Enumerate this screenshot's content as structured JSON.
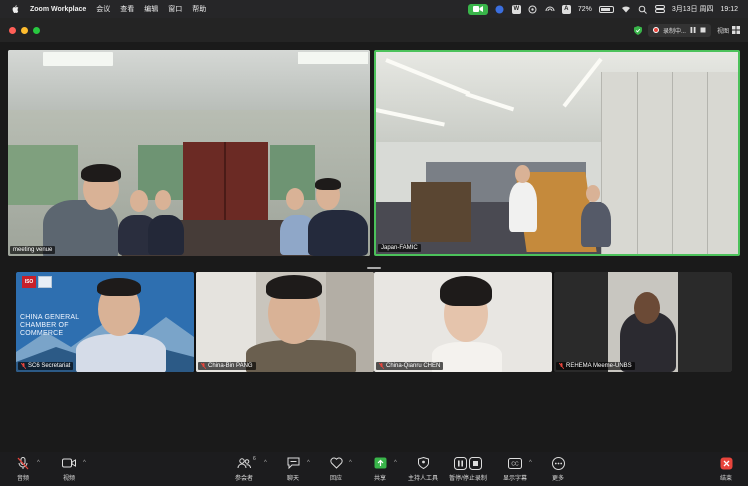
{
  "menubar": {
    "app_name": "Zoom Workplace",
    "menus": [
      "会议",
      "查看",
      "编辑",
      "窗口",
      "帮助"
    ],
    "battery": "72%",
    "datetime": "3月13日 周四",
    "clock": "19:12"
  },
  "titlebar": {
    "recording_label": "录制中...",
    "view_label": "视图"
  },
  "tiles": {
    "venue_name": "meeting venue",
    "famic_name": "Japan-FAMIC",
    "p1_name": "SC6 Secretariat",
    "p1_slide_text": "CHINA GENERAL CHAMBER OF COMMERCE",
    "p1_iso": "ISO",
    "p2_name": "China-Bin PANG",
    "p3_name": "China-Qianru CHEN",
    "p4_name": "REHEMA Meeme-UNBS"
  },
  "toolbar": {
    "audio": "音频",
    "video": "视频",
    "participants": "参会者",
    "participants_count": "6",
    "chat": "聊天",
    "react": "回应",
    "share": "共享",
    "host_tools": "主持人工具",
    "record": "暂停/停止录制",
    "captions": "显示字幕",
    "more": "更多",
    "end": "结束"
  },
  "colors": {
    "accent_green": "#4cc25b",
    "end_red": "#e8453c",
    "share_green": "#39b54a"
  }
}
